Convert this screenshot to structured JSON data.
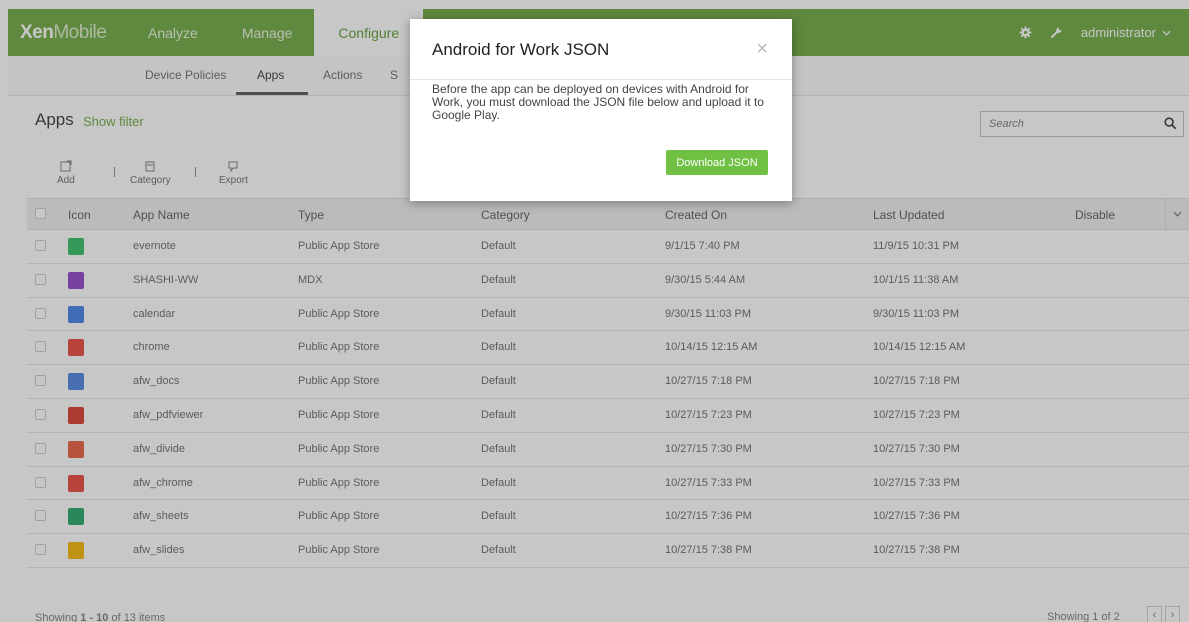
{
  "topbar": {
    "logo_bold": "Xen",
    "logo_light": "Mobile",
    "tabs": [
      {
        "label": "Analyze"
      },
      {
        "label": "Manage"
      },
      {
        "label": "Configure"
      }
    ],
    "user": "administrator",
    "icons": [
      "gear-icon",
      "wrench-icon",
      "chevron-down-icon"
    ]
  },
  "subnav": {
    "tabs": [
      {
        "label": "Device Policies"
      },
      {
        "label": "Apps"
      },
      {
        "label": "Actions"
      },
      {
        "label": "S"
      }
    ]
  },
  "page": {
    "title": "Apps",
    "show_filter": "Show filter",
    "search_placeholder": "Search"
  },
  "toolbar": {
    "add": "Add",
    "category": "Category",
    "export": "Export",
    "separator": "|"
  },
  "table": {
    "columns": [
      "Icon",
      "App Name",
      "Type",
      "Category",
      "Created On",
      "Last Updated",
      "Disable"
    ],
    "rows": [
      {
        "name": "evernote",
        "type": "Public App Store",
        "category": "Default",
        "created": "9/1/15 7:40 PM",
        "updated": "11/9/15 10:31 PM",
        "icon": "evernote-icon",
        "color": "#2dbe60"
      },
      {
        "name": "SHASHI-WW",
        "type": "MDX",
        "category": "Default",
        "created": "9/30/15 5:44 AM",
        "updated": "10/1/15 11:38 AM",
        "icon": "butterfly-icon",
        "color": "#8e3fc4"
      },
      {
        "name": "calendar",
        "type": "Public App Store",
        "category": "Default",
        "created": "9/30/15 11:03 PM",
        "updated": "9/30/15 11:03 PM",
        "icon": "calendar-icon",
        "color": "#3f7ee8"
      },
      {
        "name": "chrome",
        "type": "Public App Store",
        "category": "Default",
        "created": "10/14/15 12:15 AM",
        "updated": "10/14/15 12:15 AM",
        "icon": "chrome-icon",
        "color": "#e94235"
      },
      {
        "name": "afw_docs",
        "type": "Public App Store",
        "category": "Default",
        "created": "10/27/15 7:18 PM",
        "updated": "10/27/15 7:18 PM",
        "icon": "docs-icon",
        "color": "#4a7fe0"
      },
      {
        "name": "afw_pdfviewer",
        "type": "Public App Store",
        "category": "Default",
        "created": "10/27/15 7:23 PM",
        "updated": "10/27/15 7:23 PM",
        "icon": "pdfviewer-icon",
        "color": "#d9352b"
      },
      {
        "name": "afw_divide",
        "type": "Public App Store",
        "category": "Default",
        "created": "10/27/15 7:30 PM",
        "updated": "10/27/15 7:30 PM",
        "icon": "divide-icon",
        "color": "#e8593a"
      },
      {
        "name": "afw_chrome",
        "type": "Public App Store",
        "category": "Default",
        "created": "10/27/15 7:33 PM",
        "updated": "10/27/15 7:33 PM",
        "icon": "chrome-icon",
        "color": "#e94235"
      },
      {
        "name": "afw_sheets",
        "type": "Public App Store",
        "category": "Default",
        "created": "10/27/15 7:36 PM",
        "updated": "10/27/15 7:36 PM",
        "icon": "sheets-icon",
        "color": "#1fa463"
      },
      {
        "name": "afw_slides",
        "type": "Public App Store",
        "category": "Default",
        "created": "10/27/15 7:38 PM",
        "updated": "10/27/15 7:38 PM",
        "icon": "slides-icon",
        "color": "#f4b400"
      }
    ]
  },
  "footer": {
    "showing_prefix": "Showing ",
    "showing_range": "1 - 10",
    "showing_suffix": " of 13 items",
    "page_info": "Showing 1 of 2",
    "prev": "‹",
    "next": "›"
  },
  "modal": {
    "title": "Android for Work JSON",
    "close": "×",
    "body": "Before the app can be deployed on devices with Android for Work, you must download the JSON file below and upload it to Google Play.",
    "button": "Download JSON"
  },
  "colors": {
    "brand_green": "#6aa63c",
    "button_green": "#6fc043"
  }
}
